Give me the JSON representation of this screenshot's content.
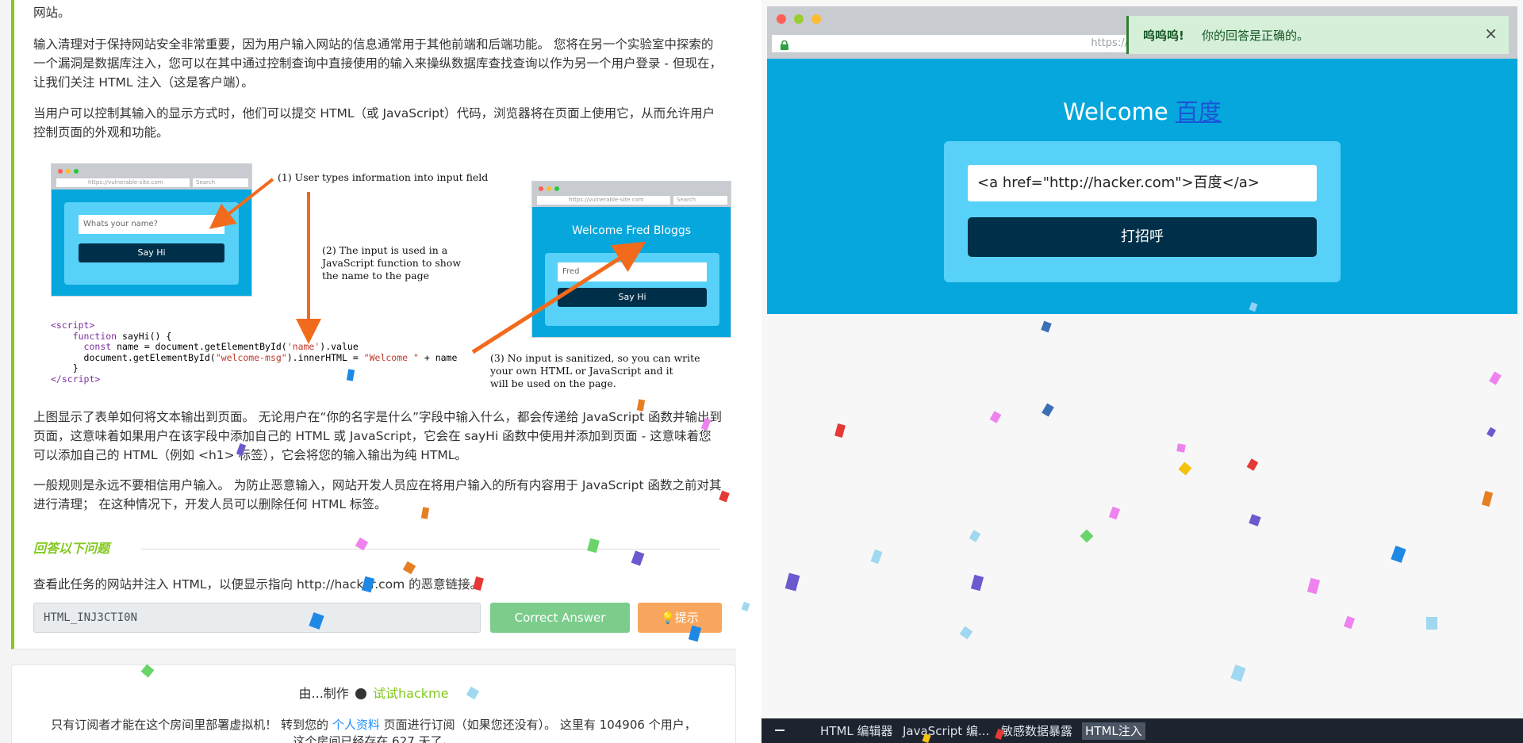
{
  "left": {
    "intro_tail": "网站。",
    "sanitize_paragraph": "输入清理对于保持网站安全非常重要，因为用户输入网站的信息通常用于其他前端和后端功能。 您将在另一个实验室中探索的一个漏洞是数据库注入，您可以在其中通过控制查询中直接使用的输入来操纵数据库查找查询以作为另一个用户登录 - 但现在，让我们关注 HTML 注入（这是客户端）。",
    "html_injection_paragraph": "当用户可以控制其输入的显示方式时，他们可以提交 HTML（或 JavaScript）代码，浏览器将在页面上使用它，从而允许用户控制页面的外观和功能。",
    "figure": {
      "url": "https://vulnerable-site.com",
      "search": "Search",
      "input_placeholder": "Whats your name?",
      "button": "Say Hi",
      "welcome": "Welcome Fred Bloggs",
      "fred_value": "Fred",
      "note1": "(1) User types information into input field",
      "note2_l1": "(2) The input is used in a",
      "note2_l2": "JavaScript function to show",
      "note2_l3": "the name to the page",
      "note3_l1": "(3) No input is sanitized, so you can write",
      "note3_l2": "your own HTML or JavaScript and it",
      "note3_l3": "will be used on the page."
    },
    "figure_explain_paragraph": "上图显示了表单如何将文本输出到页面。 无论用户在“你的名字是什么”字段中输入什么，都会传递给 JavaScript 函数并输出到页面，这意味着如果用户在该字段中添加自己的 HTML 或 JavaScript，它会在 sayHi 函数中使用并添加到页面 - 这意味着您可以添加自己的 HTML（例如 <h1> 标签），它会将您的输入输出为纯 HTML。",
    "rule_paragraph": "一般规则是永远不要相信用户输入。 为防止恶意输入，网站开发人员应在将用户输入的所有内容用于 JavaScript 函数之前对其进行清理； 在这种情况下，开发人员可以删除任何 HTML 标签。",
    "section_heading": "回答以下问题",
    "question": "查看此任务的网站并注入 HTML，以便显示指向 http://hacker.com 的恶意链接。",
    "answer_value": "HTML_INJ3CTI0N",
    "correct_button": "Correct Answer",
    "hint_button": "提示",
    "made_by_prefix": "由...制作",
    "author": "试试hackme",
    "subscription_note_prefix": "只有订阅者才能在这个房间里部署虚拟机！ 转到您的",
    "subscription_link": "个人资料",
    "subscription_note_suffix": "页面进行订阅（如果您还没有）。 这里有 104906 个用户，",
    "subscription_note_line2": "这个房间已经存在 627 天了。"
  },
  "browser": {
    "url": "https://vulnerable-site.com",
    "welcome_prefix": "Welcome",
    "welcome_link": "百度",
    "input_value": "<a href=\"http://hacker.com\">百度</a>",
    "button": "打招呼"
  },
  "toast": {
    "title": "呜呜呜!",
    "message": "你的回答是正确的。",
    "close": "×"
  },
  "taskbar": {
    "tabs": [
      "HTML 编辑器",
      "JavaScript 编...",
      "敏感数据暴露",
      "HTML注入"
    ],
    "active_index": 3
  },
  "colors": {
    "accent_green": "#82c91e",
    "site_blue": "#06a7dc",
    "card_blue": "#57d1f7",
    "dark_navy": "#003049",
    "success_button": "#7ccd8c",
    "hint_button": "#f8a65d",
    "toast_bg": "#d5efd9"
  }
}
